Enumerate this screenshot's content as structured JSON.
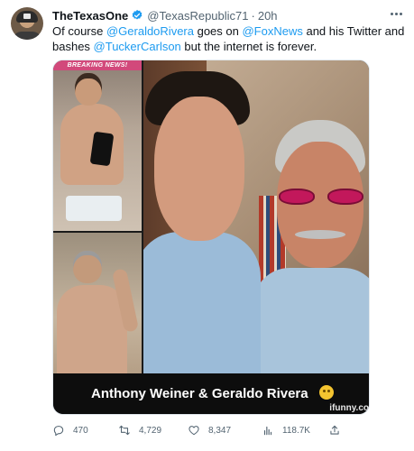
{
  "tweet": {
    "author": {
      "display_name": "TheTexasOne",
      "handle": "@TexasRepublic71",
      "separator": "·",
      "time": "20h",
      "verified": true
    },
    "text": {
      "p1": "Of course ",
      "m1": "@GeraldoRivera",
      "p2": " goes on ",
      "m2": "@FoxNews",
      "p3": " and his Twitter and bashes ",
      "m3": "@TuckerCarlson",
      "p4": " but the internet is forever."
    },
    "media": {
      "banner": "BREAKING NEWS!",
      "caption": "Anthony Weiner & Geraldo Rivera",
      "watermark": "ifunny.co",
      "emoji": "thinking-face"
    },
    "actions": {
      "replies": "470",
      "retweets": "4,729",
      "likes": "8,347",
      "views": "118.7K"
    },
    "colors": {
      "accent": "#1d9bf0",
      "muted": "#536471",
      "text": "#0f1419",
      "banner": "#d2497b"
    },
    "icons": [
      "more-icon",
      "verified-icon",
      "reply-icon",
      "retweet-icon",
      "like-icon",
      "views-icon",
      "share-icon"
    ]
  }
}
